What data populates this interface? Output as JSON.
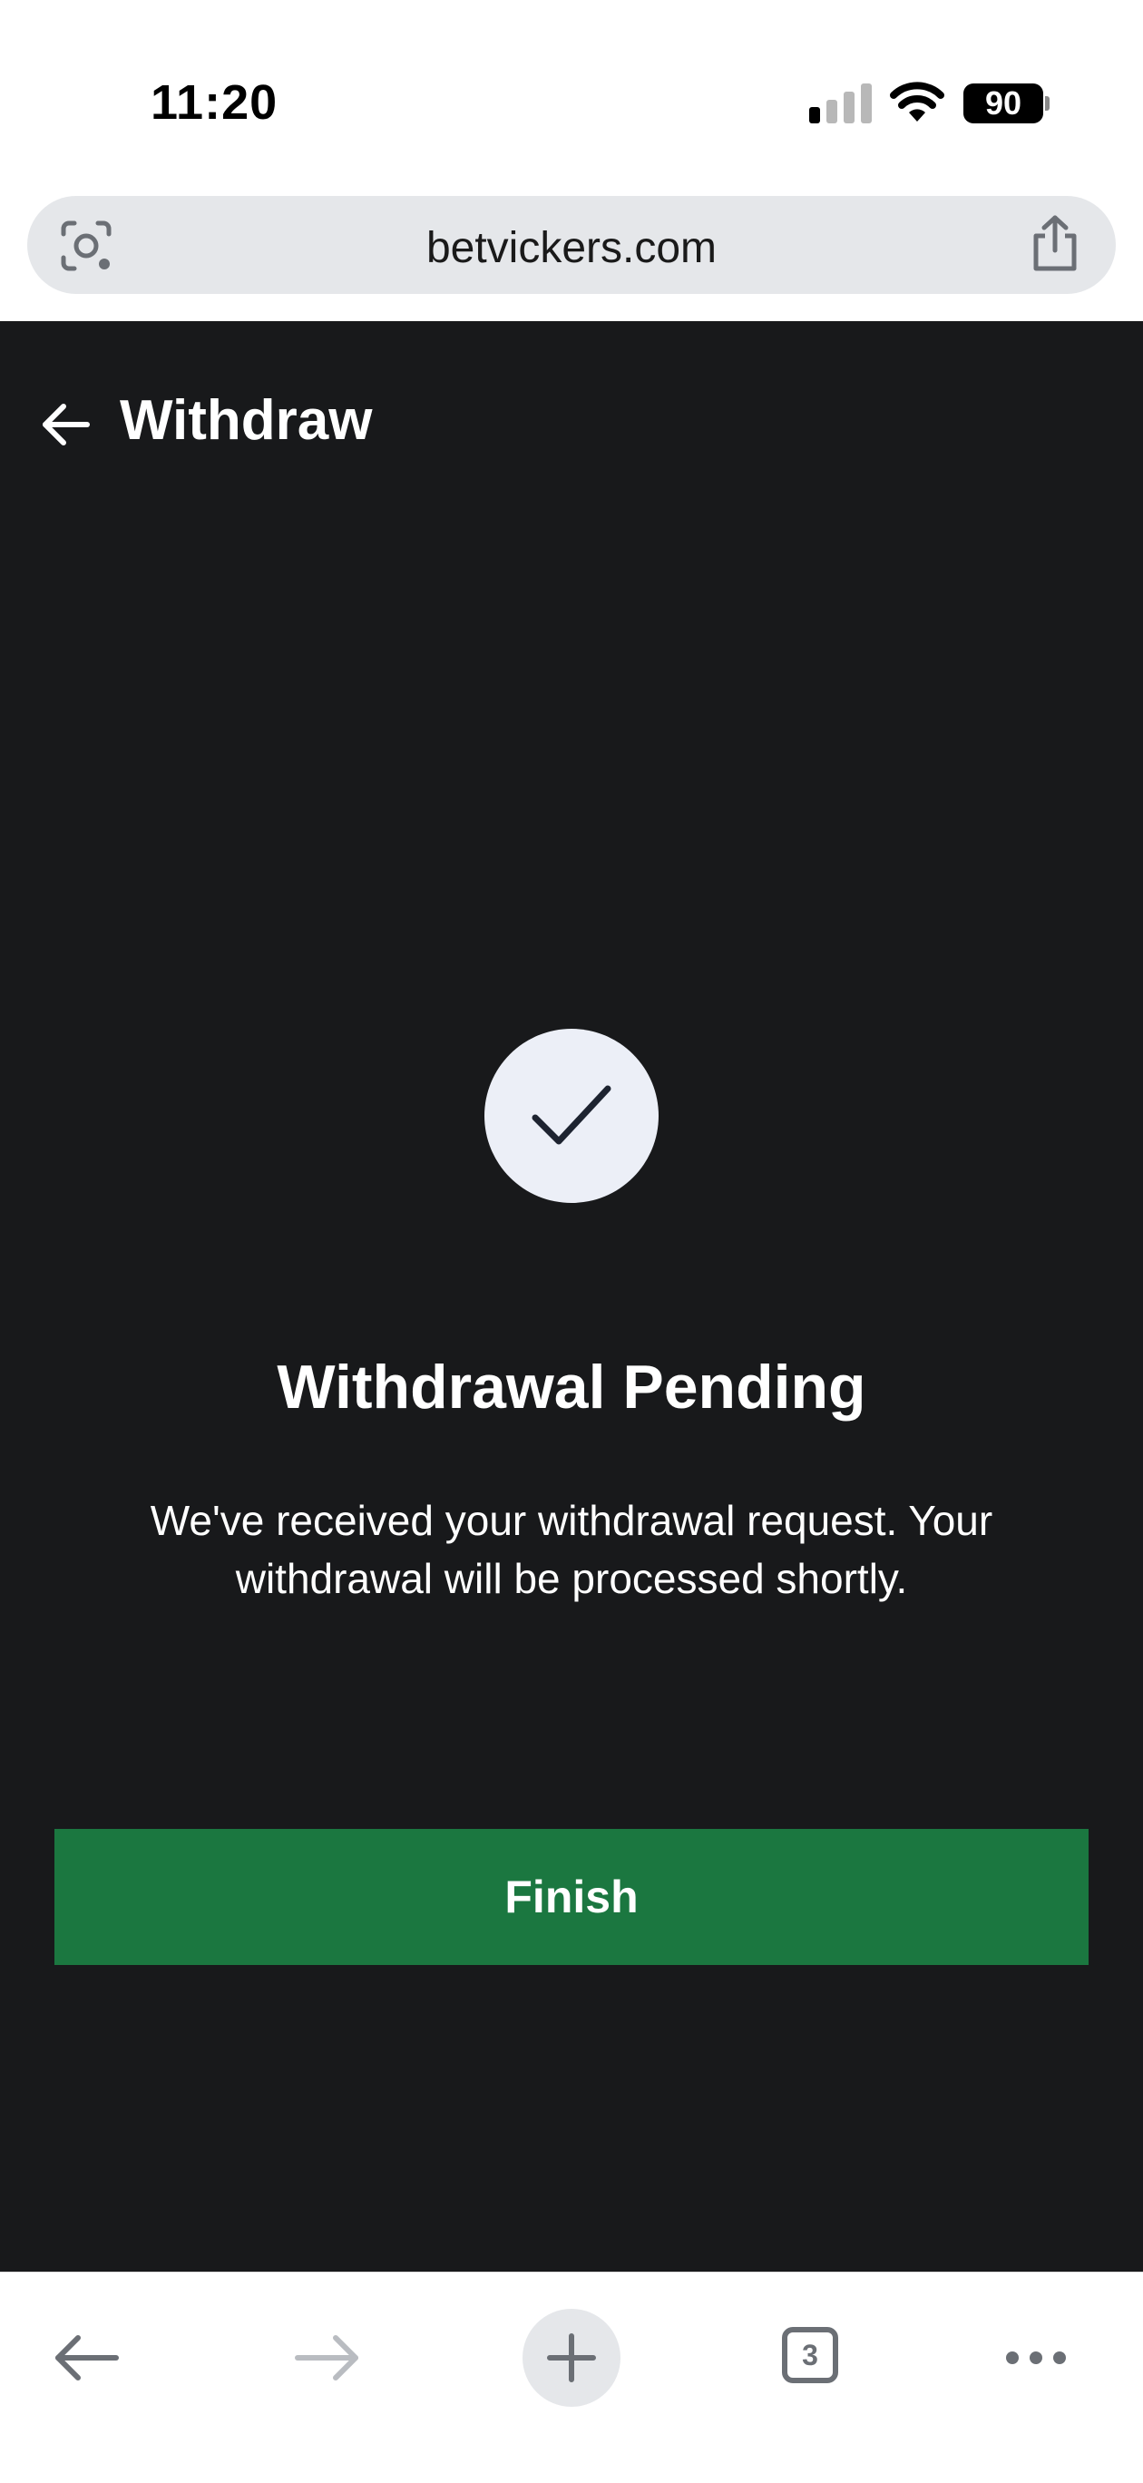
{
  "status_bar": {
    "time": "11:20",
    "battery_level": "90"
  },
  "browser": {
    "url": "betvickers.com",
    "tab_count": "3"
  },
  "header": {
    "title": "Withdraw"
  },
  "content": {
    "headline": "Withdrawal Pending",
    "message": "We've received your withdrawal request. Your withdrawal will be processed shortly.",
    "finish_label": "Finish"
  },
  "icons": {
    "lens": "lens-icon",
    "share": "share-icon",
    "back": "arrow-left-icon",
    "success": "checkmark-icon",
    "new_tab": "plus-icon",
    "more": "ellipsis-icon"
  },
  "colors": {
    "app_background": "#18191b",
    "primary_button": "#1b7740",
    "success_circle": "#eceff7",
    "text_on_dark": "#ffffff"
  }
}
